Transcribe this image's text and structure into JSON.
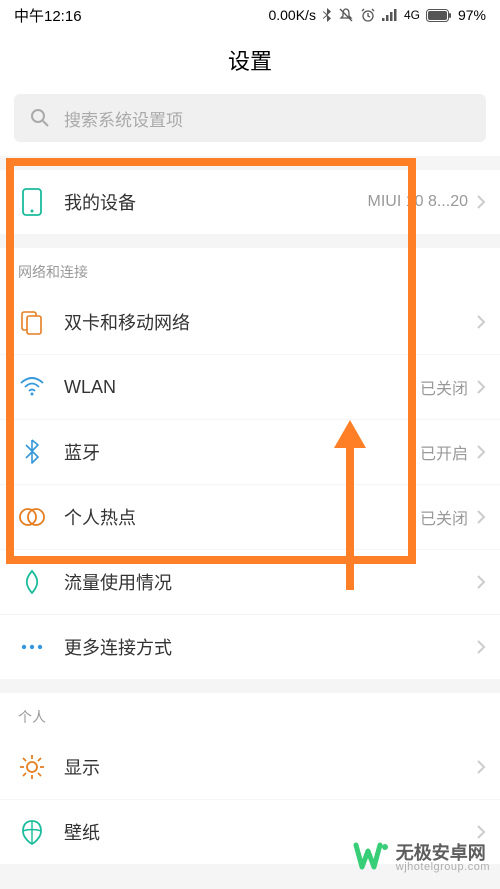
{
  "status": {
    "time": "中午12:16",
    "net_speed": "0.00K/s",
    "network": "4G",
    "battery": "97%"
  },
  "title": "设置",
  "search": {
    "placeholder": "搜索系统设置项"
  },
  "section1": {
    "my_device": {
      "label": "我的设备",
      "value": "MIUI 10 8...20"
    }
  },
  "section_network_header": "网络和连接",
  "network": {
    "sim": {
      "label": "双卡和移动网络",
      "value": ""
    },
    "wlan": {
      "label": "WLAN",
      "value": "已关闭"
    },
    "bluetooth": {
      "label": "蓝牙",
      "value": "已开启"
    },
    "hotspot": {
      "label": "个人热点",
      "value": "已关闭"
    },
    "data_usage": {
      "label": "流量使用情况",
      "value": ""
    },
    "more": {
      "label": "更多连接方式",
      "value": ""
    }
  },
  "section_personal_header": "个人",
  "personal": {
    "display": {
      "label": "显示",
      "value": ""
    },
    "wallpaper": {
      "label": "壁纸",
      "value": ""
    }
  },
  "watermark": {
    "brand": "无极安卓网",
    "url": "wjhotelgroup.com"
  },
  "colors": {
    "annotation": "#ff7f27",
    "icon_teal": "#1abc9c",
    "icon_blue": "#3498db",
    "icon_orange": "#e67e22",
    "icon_green": "#2ecc71"
  }
}
